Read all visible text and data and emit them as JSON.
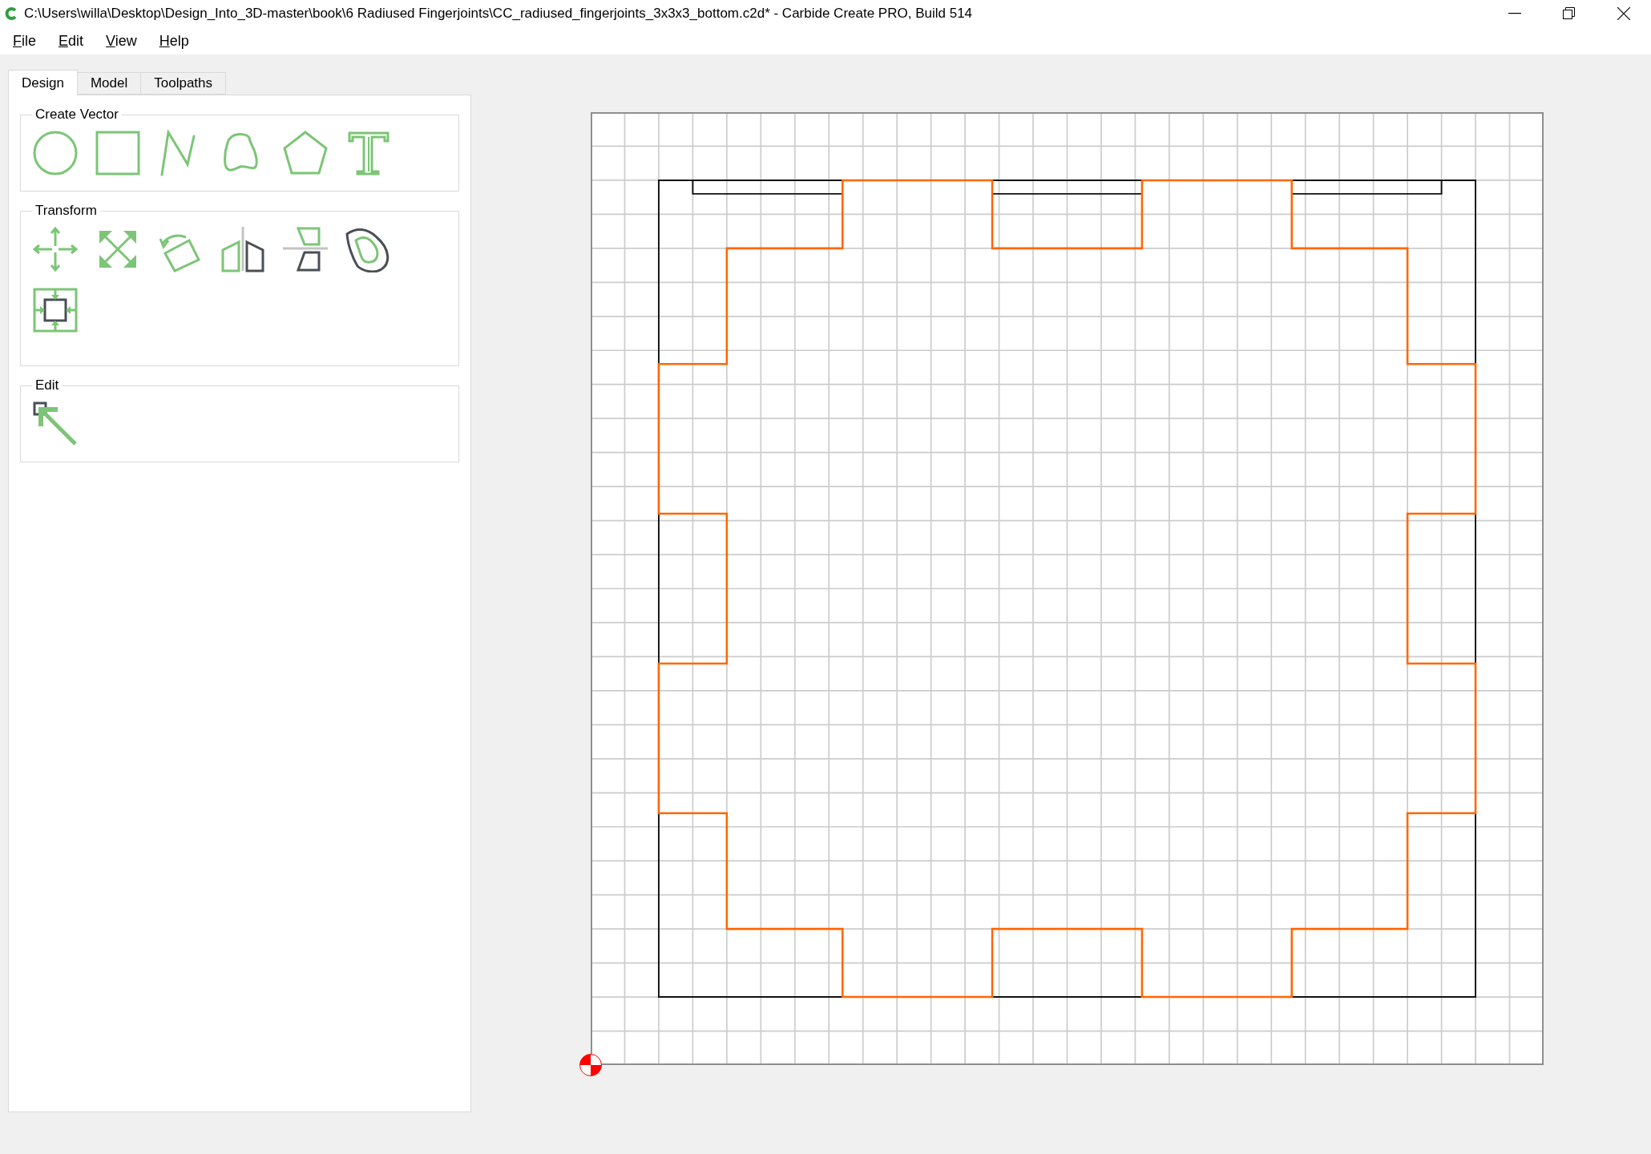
{
  "window": {
    "title": "C:\\Users\\willa\\Desktop\\Design_Into_3D-master\\book\\6 Radiused Fingerjoints\\CC_radiused_fingerjoints_3x3x3_bottom.c2d* - Carbide Create PRO, Build 514"
  },
  "menu": [
    "File",
    "Edit",
    "View",
    "Help"
  ],
  "tabs": [
    {
      "label": "Design",
      "selected": true
    },
    {
      "label": "Model",
      "selected": false
    },
    {
      "label": "Toolpaths",
      "selected": false
    }
  ],
  "tool_groups": [
    {
      "title": "Create Vector",
      "tools": [
        {
          "kind": "circle"
        },
        {
          "kind": "rectangle"
        },
        {
          "kind": "polyline"
        },
        {
          "kind": "curve"
        },
        {
          "kind": "polygon"
        },
        {
          "kind": "text"
        }
      ]
    },
    {
      "title": "Transform",
      "tools": [
        {
          "kind": "move"
        },
        {
          "kind": "scale"
        },
        {
          "kind": "rotate"
        },
        {
          "kind": "mirror"
        },
        {
          "kind": "flip"
        },
        {
          "kind": "offset"
        },
        {
          "kind": "align"
        }
      ]
    },
    {
      "title": "Edit",
      "tools": [
        {
          "kind": "select"
        }
      ]
    }
  ]
}
